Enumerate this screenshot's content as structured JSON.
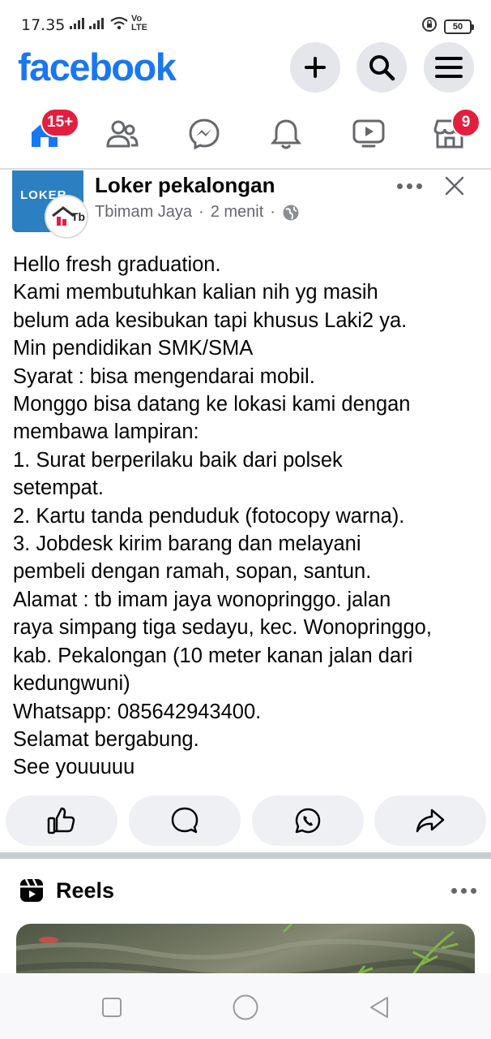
{
  "status_bar": {
    "time": "17.35",
    "battery": "50",
    "network_label": "Vo LTE"
  },
  "header": {
    "logo": "facebook",
    "buttons": [
      {
        "name": "create",
        "icon": "plus-icon"
      },
      {
        "name": "search",
        "icon": "search-icon"
      },
      {
        "name": "menu",
        "icon": "hamburger-icon"
      }
    ]
  },
  "tabs": [
    {
      "name": "home",
      "icon": "home-icon",
      "badge": "15+",
      "active": true
    },
    {
      "name": "friends",
      "icon": "friends-icon",
      "badge": ""
    },
    {
      "name": "messenger",
      "icon": "messenger-icon",
      "badge": ""
    },
    {
      "name": "notifications",
      "icon": "bell-icon",
      "badge": ""
    },
    {
      "name": "watch",
      "icon": "video-icon",
      "badge": ""
    },
    {
      "name": "marketplace",
      "icon": "store-icon",
      "badge": "9"
    }
  ],
  "post": {
    "group_name": "Loker pekalongan",
    "author": "Tbimam Jaya",
    "time": "2 menit",
    "separator": "·",
    "avatar_text": "LOKER",
    "sub_avatar_text": "Tb",
    "body_lines": [
      "Hello fresh graduation.",
      "Kami membutuhkan kalian nih yg masih",
      "belum ada kesibukan tapi khusus Laki2 ya.",
      "Min pendidikan SMK/SMA",
      "Syarat : bisa mengendarai mobil.",
      "Monggo bisa datang ke lokasi kami dengan",
      "membawa lampiran:",
      "1. Surat berperilaku baik dari polsek",
      "setempat.",
      "2. Kartu tanda penduduk (fotocopy warna).",
      "3. Jobdesk kirim barang dan melayani",
      "pembeli dengan ramah, sopan, santun.",
      "Alamat : tb imam jaya wonopringgo. jalan",
      "raya simpang tiga sedayu, kec. Wonopringgo,",
      "kab. Pekalongan (10 meter kanan jalan dari",
      "kedungwuni)",
      "Whatsapp: 085642943400.",
      "Selamat bergabung.",
      "See youuuuu"
    ]
  },
  "actions": [
    {
      "name": "like",
      "icon": "thumbs-up-icon"
    },
    {
      "name": "comment",
      "icon": "comment-icon"
    },
    {
      "name": "whatsapp",
      "icon": "whatsapp-icon"
    },
    {
      "name": "share",
      "icon": "share-icon"
    }
  ],
  "reels": {
    "title": "Reels"
  },
  "colors": {
    "brand": "#1877f2",
    "badge": "#e41e3f",
    "secondary_text": "#65676b",
    "button_bg": "#e4e6eb"
  }
}
